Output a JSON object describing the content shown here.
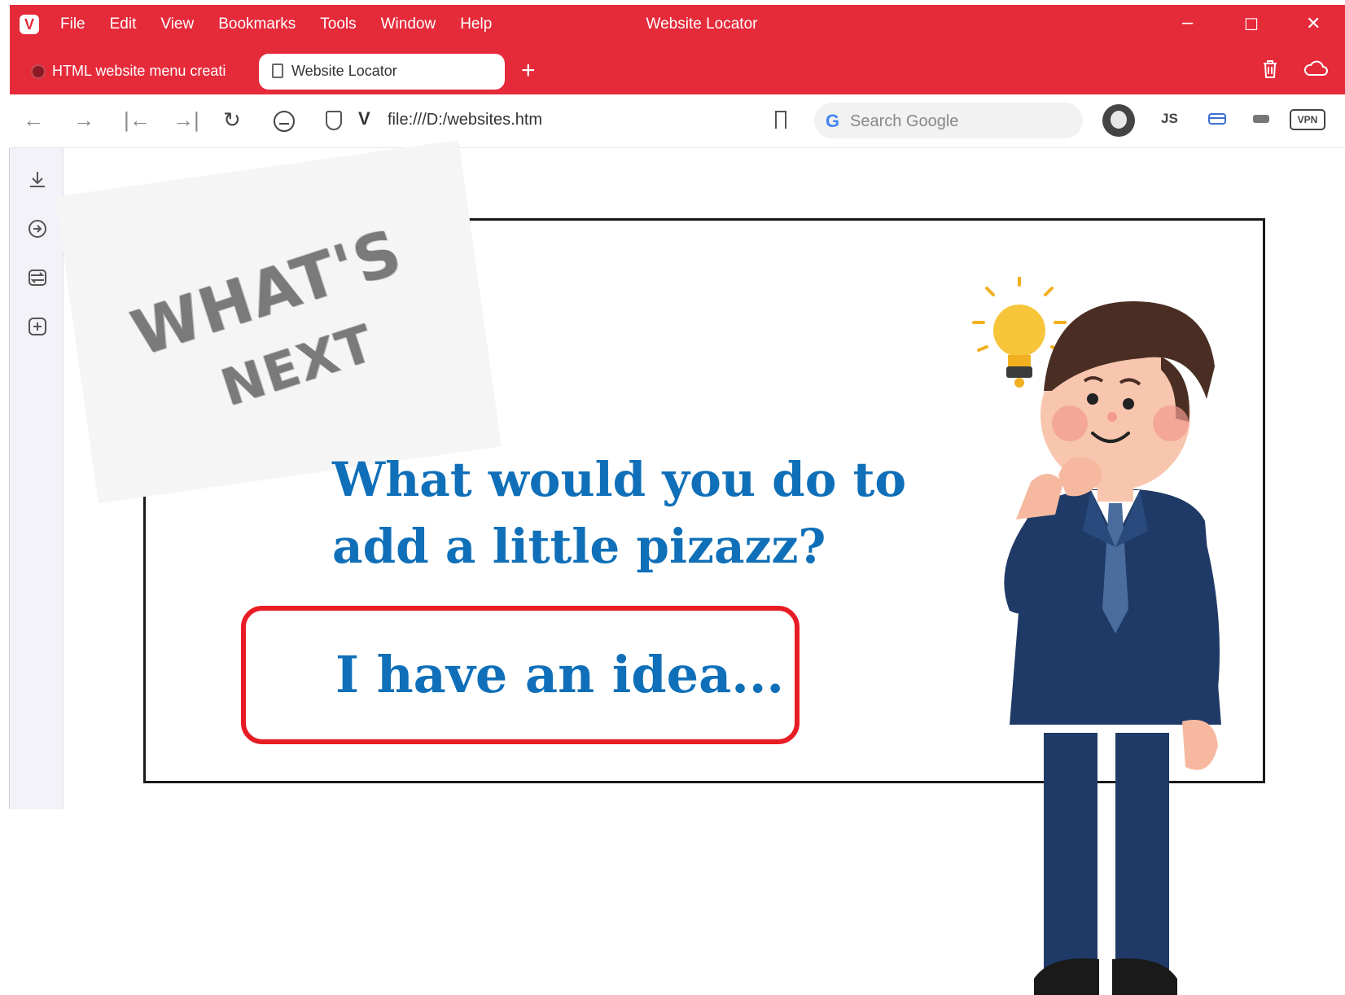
{
  "window": {
    "title": "Website Locator",
    "menu": [
      "File",
      "Edit",
      "View",
      "Bookmarks",
      "Tools",
      "Window",
      "Help"
    ],
    "controls": {
      "minimize": "–",
      "maximize": "☐",
      "close": "✕"
    }
  },
  "tabs": [
    {
      "label": "HTML website menu creati",
      "active": false
    },
    {
      "label": "Website Locator",
      "active": true
    }
  ],
  "new_tab": "+",
  "toolbar": {
    "back": "←",
    "forward": "→",
    "first": "|←",
    "last": "→|",
    "reload": "↻",
    "url": "file:///D:/websites.htm",
    "v_mark": "V",
    "search_placeholder": "Search Google",
    "search_g": "G",
    "js_label": "JS",
    "vpn_label": "VPN"
  },
  "slide": {
    "badge_line1": "WHAT'S",
    "badge_line2": "NEXT",
    "question_line1": "What would you do to",
    "question_line2": "add a little pizazz?",
    "idea": "I have an idea..."
  },
  "colors": {
    "browser_red": "#e52a3a",
    "heading_blue": "#0f6fb8",
    "highlight_red": "#e81c24",
    "suit_navy": "#1f3a66"
  }
}
